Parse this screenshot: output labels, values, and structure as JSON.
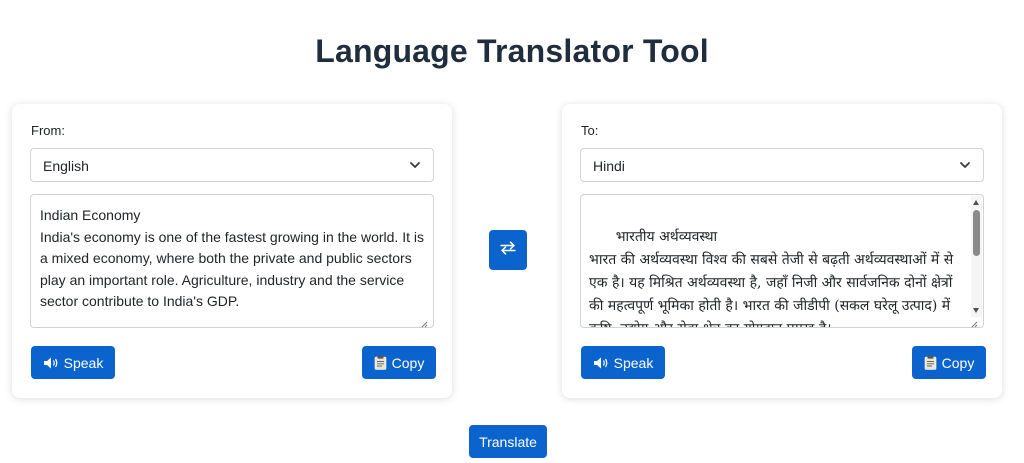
{
  "header": {
    "title": "Language Translator Tool"
  },
  "source": {
    "label": "From:",
    "language": "English",
    "text": "Indian Economy\nIndia's economy is one of the fastest growing in the world. It is a mixed economy, where both the private and public sectors play an important role. Agriculture, industry and the service sector contribute to India's GDP.",
    "speak_label": "Speak",
    "copy_label": "Copy"
  },
  "target": {
    "label": "To:",
    "language": "Hindi",
    "text": "भारतीय अर्थव्यवस्था\nभारत की अर्थव्यवस्था विश्व की सबसे तेजी से बढ़ती अर्थव्यवस्थाओं में से एक है। यह मिश्रित अर्थव्यवस्था है, जहाँ निजी और सार्वजनिक दोनों क्षेत्रों की महत्वपूर्ण भूमिका होती है। भारत की जीडीपी (सकल घरेलू उत्पाद) में कृषि, उद्योग और सेवा क्षेत्र का योगदान प्रमुख है।",
    "speak_label": "Speak",
    "copy_label": "Copy"
  },
  "actions": {
    "translate_label": "Translate"
  },
  "icons": {
    "speak": "speaker-icon",
    "copy": "clipboard-icon",
    "swap": "swap-arrows-icon",
    "select": "chevron-down-icon"
  },
  "colors": {
    "primary": "#0b63ce",
    "title": "#1f2d3d",
    "border": "#ced4da"
  }
}
